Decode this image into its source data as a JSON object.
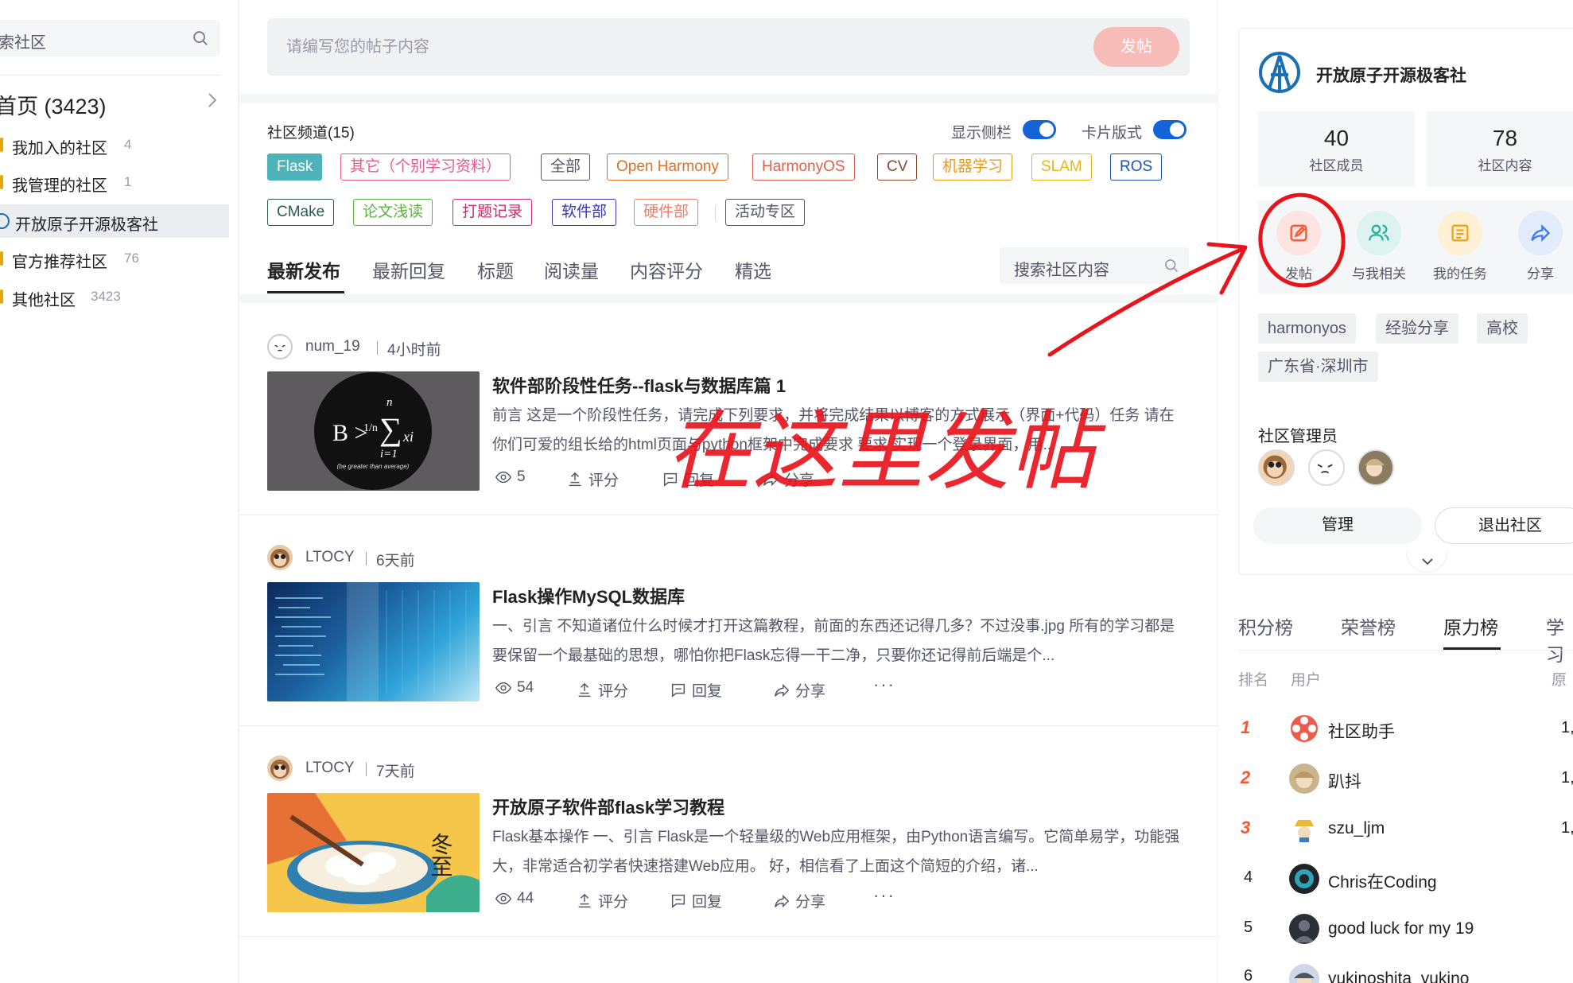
{
  "left": {
    "search_text": "索社区",
    "home": "首页 (3423)",
    "items": [
      {
        "label": "我加入的社区",
        "count": "4"
      },
      {
        "label": "我管理的社区",
        "count": "1"
      },
      {
        "label": "开放原子开源极客社",
        "count": ""
      },
      {
        "label": "官方推荐社区",
        "count": "76"
      },
      {
        "label": "其他社区",
        "count": "3423"
      }
    ]
  },
  "post": {
    "placeholder": "请编写您的帖子内容",
    "button": "发帖"
  },
  "channels": {
    "title": "社区频道(15)",
    "toggle_sidebar": "显示侧栏",
    "toggle_card": "卡片版式",
    "tags": [
      {
        "label": "Flask",
        "color": "#4db3b8"
      },
      {
        "label": "其它（个别学习资料）",
        "color": "#e85a8f"
      },
      {
        "label": "全部",
        "color": "#555666"
      },
      {
        "label": "Open Harmony",
        "color": "#e07025"
      },
      {
        "label": "HarmonyOS",
        "color": "#e05f4b"
      },
      {
        "label": "CV",
        "color": "#8a4a2a"
      },
      {
        "label": "机器学习",
        "color": "#e89a17"
      },
      {
        "label": "SLAM",
        "color": "#e8b817"
      },
      {
        "label": "ROS",
        "color": "#1f4fb5"
      },
      {
        "label": "CMake",
        "color": "#2a5b4f"
      },
      {
        "label": "论文浅读",
        "color": "#5ab340"
      },
      {
        "label": "打题记录",
        "color": "#d0276d"
      },
      {
        "label": "软件部",
        "color": "#3a35b0"
      },
      {
        "label": "硬件部",
        "color": "#f07d6c"
      },
      {
        "label": "活动专区",
        "color": "#555666"
      }
    ],
    "tabs": [
      "最新发布",
      "最新回复",
      "标题",
      "阅读量",
      "内容评分",
      "精选"
    ],
    "search_placeholder": "搜索社区内容"
  },
  "posts": [
    {
      "author": "num_19",
      "time": "4小时前",
      "title": "软件部阶段性任务--flask与数据库篇 1",
      "desc": "前言 这是一个阶段性任务，请完成下列要求，并将完成结果以博客的方式展示（界面+代码）任务 请在你们可爱的组长给的html页面与python框架中完成要求 要求 实现一个登录界面，用...",
      "views": "5",
      "rate": "评分",
      "reply": "回复",
      "share": "分享"
    },
    {
      "author": "LTOCY",
      "time": "6天前",
      "title": "Flask操作MySQL数据库",
      "desc": "一、引言 不知道诸位什么时候才打开这篇教程，前面的东西还记得几多？不过没事.jpg 所有的学习都是要保留一个最基础的思想，哪怕你把Flask忘得一干二净，只要你还记得前后端是个...",
      "views": "54",
      "rate": "评分",
      "reply": "回复",
      "share": "分享"
    },
    {
      "author": "LTOCY",
      "time": "7天前",
      "title": "开放原子软件部flask学习教程",
      "desc": "Flask基本操作 一、引言 Flask是一个轻量级的Web应用框架，由Python语言编写。它简单易学，功能强大，非常适合初学者快速搭建Web应用。 好，相信看了上面这个简短的介绍，诸...",
      "views": "44",
      "rate": "评分",
      "reply": "回复",
      "share": "分享"
    }
  ],
  "thumb1": {
    "formula_main": "B >",
    "frac": "1/n",
    "sum_top": "n",
    "sum_bot": "i=1",
    "xi": "xi",
    "caption": "(be greater than average)"
  },
  "thumb3": {
    "text": "冬至"
  },
  "community": {
    "name": "开放原子开源极客社",
    "members": "40",
    "members_label": "社区成员",
    "contents": "78",
    "contents_label": "社区内容",
    "actions": [
      "发帖",
      "与我相关",
      "我的任务",
      "分享"
    ],
    "tags": [
      "harmonyos",
      "经验分享",
      "高校",
      "广东省·深圳市"
    ],
    "admins_title": "社区管理员",
    "manage": "管理",
    "quit": "退出社区"
  },
  "ranks": {
    "tabs": [
      "积分榜",
      "荣誉榜",
      "原力榜",
      "学习"
    ],
    "head_rank": "排名",
    "head_user": "用户",
    "head_val": "原",
    "rows": [
      {
        "n": "1",
        "name": "社区助手",
        "val": "1,"
      },
      {
        "n": "2",
        "name": "趴抖",
        "val": "1,"
      },
      {
        "n": "3",
        "name": "szu_ljm",
        "val": "1,"
      },
      {
        "n": "4",
        "name": "Chris在Coding",
        "val": ""
      },
      {
        "n": "5",
        "name": "good luck for my 19",
        "val": ""
      },
      {
        "n": "6",
        "name": "yukinoshita_yukino",
        "val": ""
      }
    ]
  },
  "annotation": "在这里发帖"
}
